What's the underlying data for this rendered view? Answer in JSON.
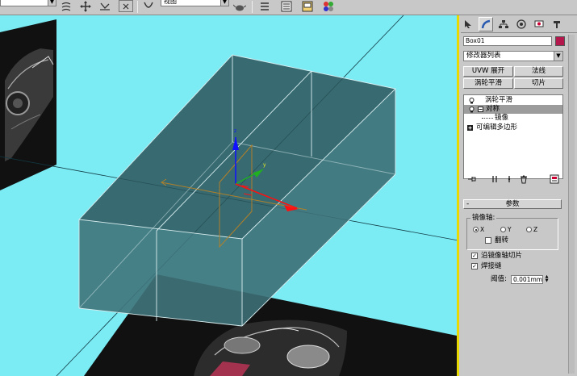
{
  "toolbar": {
    "selection_set": "视图"
  },
  "panel": {
    "object_name": "Box01",
    "object_color": "#b4174b",
    "modifier_list": "修改器列表",
    "buttons": {
      "uvw_unwrap": "UVW 展开",
      "normal": "法线",
      "turbosmooth": "涡轮平滑",
      "slice": "切片"
    },
    "stack": [
      {
        "label": "涡轮平滑",
        "selected": false
      },
      {
        "label": "对称",
        "selected": true
      },
      {
        "label": "镜像",
        "selected": false
      },
      {
        "label": "可编辑多边形",
        "selected": false
      }
    ],
    "rollout": {
      "title": "参数",
      "mirror_axis_group": "镜像轴:",
      "axes": [
        "X",
        "Y",
        "Z"
      ],
      "selected_axis": "X",
      "flip_label": "翻转",
      "flip_checked": false,
      "slice_along_mirror_label": "沿镜像轴切片",
      "slice_along_mirror_checked": true,
      "weld_seam_label": "焊接缝",
      "weld_seam_checked": true,
      "threshold_label": "阈值:",
      "threshold_value": "0.001mm"
    }
  },
  "viewport": {
    "background_color": "#7bebf4"
  }
}
